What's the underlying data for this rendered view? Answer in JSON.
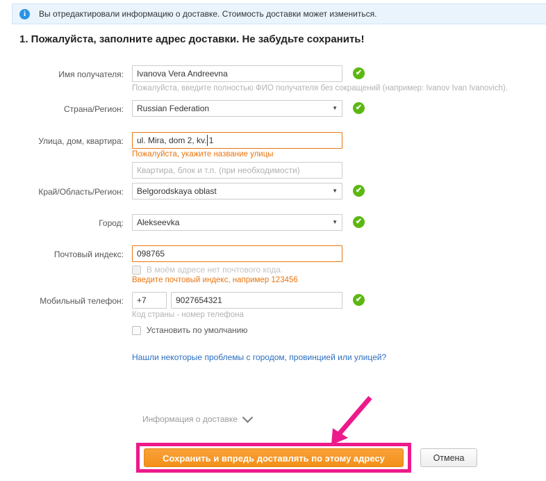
{
  "banner": {
    "icon": "info-icon",
    "text": "Вы отредактировали информацию о доставке. Стоимость доставки может измениться."
  },
  "heading": "1. Пожалуйста, заполните адрес доставки. Не забудьте сохранить!",
  "form": {
    "recipient": {
      "label": "Имя получателя:",
      "value": "Ivanova Vera Andreevna",
      "hint": "Пожалуйста, введите полностью ФИО получателя без сокращений (например: Ivanov Ivan Ivanovich).",
      "status": "valid"
    },
    "country": {
      "label": "Страна/Регион:",
      "value": "Russian Federation",
      "status": "valid"
    },
    "street": {
      "label": "Улица, дом, квартира:",
      "value": "ul. Mira, dom 2, kv. 1",
      "error": "Пожалуйста, укажите название улицы",
      "apartment_placeholder": "Квартира, блок и т.п. (при необходимости)",
      "apartment_value": "",
      "status": "error"
    },
    "region": {
      "label": "Край/Область/Регион:",
      "value": "Belgorodskaya oblast",
      "status": "valid"
    },
    "city": {
      "label": "Город:",
      "value": "Alekseevka",
      "status": "valid"
    },
    "postal": {
      "label": "Почтовый индекс:",
      "value": "098765",
      "no_postcode_label": "В моём адресе нет почтового кода.",
      "error": "Введите почтовый индекс, например 123456",
      "status": "error"
    },
    "phone": {
      "label": "Мобильный телефон:",
      "country_code": "+7",
      "number": "9027654321",
      "hint": "Код страны - номер телефона",
      "status": "valid"
    },
    "default_address": {
      "label": "Установить по умолчанию",
      "checked": false
    },
    "problem_link": "Нашли некоторые проблемы с городом, провинцией или улицей?"
  },
  "delivery_info_toggle": "Информация о доставке",
  "buttons": {
    "save": "Сохранить и впредь доставлять по этому адресу",
    "cancel": "Отмена"
  },
  "icons": {
    "check": "✔",
    "select_arrow": "▼",
    "info": "i"
  },
  "colors": {
    "banner_bg": "#eaf4fd",
    "banner_border": "#cfe4f7",
    "info_blue": "#2a93e8",
    "valid_green": "#5cb811",
    "error_orange": "#e87511",
    "link_blue": "#2b6ebf",
    "save_orange": "#f39019",
    "highlight_pink": "#ec1a8a"
  }
}
